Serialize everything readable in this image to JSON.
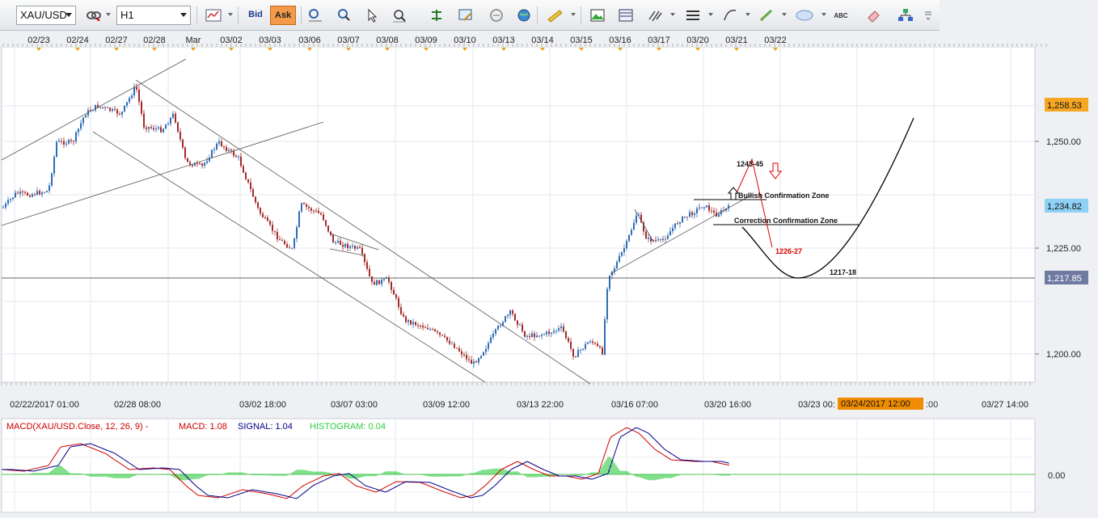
{
  "toolbar": {
    "symbol": "XAU/USD",
    "timeframe": "H1",
    "bid_label": "Bid",
    "ask_label": "Ask",
    "abc_label": "ABC"
  },
  "top_dates": [
    "02/23",
    "02/24",
    "02/27",
    "02/28",
    "Mar",
    "03/02",
    "03/03",
    "03/06",
    "03/07",
    "03/08",
    "03/09",
    "03/10",
    "03/13",
    "03/14",
    "03/15",
    "03/16",
    "03/17",
    "03/20",
    "03/21",
    "03/22"
  ],
  "price_axis": [
    "1,250.00",
    "1,225.00",
    "1,200.00",
    "0.00"
  ],
  "price_tags": {
    "high": "1,258.53",
    "current": "1,234.82",
    "line": "1,217.85"
  },
  "time_axis": [
    "02/22/2017 01:00",
    "02/28 08:00",
    "03/02 18:00",
    "03/07 03:00",
    "03/09 12:00",
    "03/13 22:00",
    "03/16 07:00",
    "03/20 16:00",
    "03/23 00:",
    "03/27 14:00"
  ],
  "crosshair_time": "03/24/2017 12:00",
  "crosshair_tail": ":00",
  "annotations": {
    "target": "1243-45",
    "bullish": "Bullish Confirmation Zone",
    "correction": "Correction Confirmation Zone",
    "pullback": "1226-27",
    "support": "1217-18"
  },
  "macd": {
    "title": "MACD(XAU/USD.Close, 12, 26, 9) -",
    "macd_label": "MACD: 1.08",
    "signal_label": "SIGNAL: 1.04",
    "hist_label": "HISTOGRAM: 0.04"
  },
  "colors": {
    "up_candle": "#2e6db5",
    "down_candle": "#a52a2a",
    "tag_high": "#f5a623",
    "tag_current": "#8fd0f5",
    "tag_line": "#6f7aa0",
    "crosshair_tag": "#f08c00",
    "macd_line": "#d00000",
    "signal_line": "#00008b",
    "histogram": "#2ecc40"
  },
  "icons": [
    "link-icon",
    "indicator-icon",
    "crosshair-icon",
    "zoom-icon",
    "magnifier-icon",
    "cursor-icon",
    "chart-type-icon",
    "level-icon",
    "edit-icon",
    "tick-icon",
    "globe-icon",
    "ruler-icon",
    "picture-icon",
    "template-icon",
    "period-icon",
    "line-style-icon",
    "draw-icon",
    "pencil-icon",
    "ellipse-icon",
    "text-icon",
    "eraser-icon",
    "tree-icon",
    "more-icon"
  ]
}
